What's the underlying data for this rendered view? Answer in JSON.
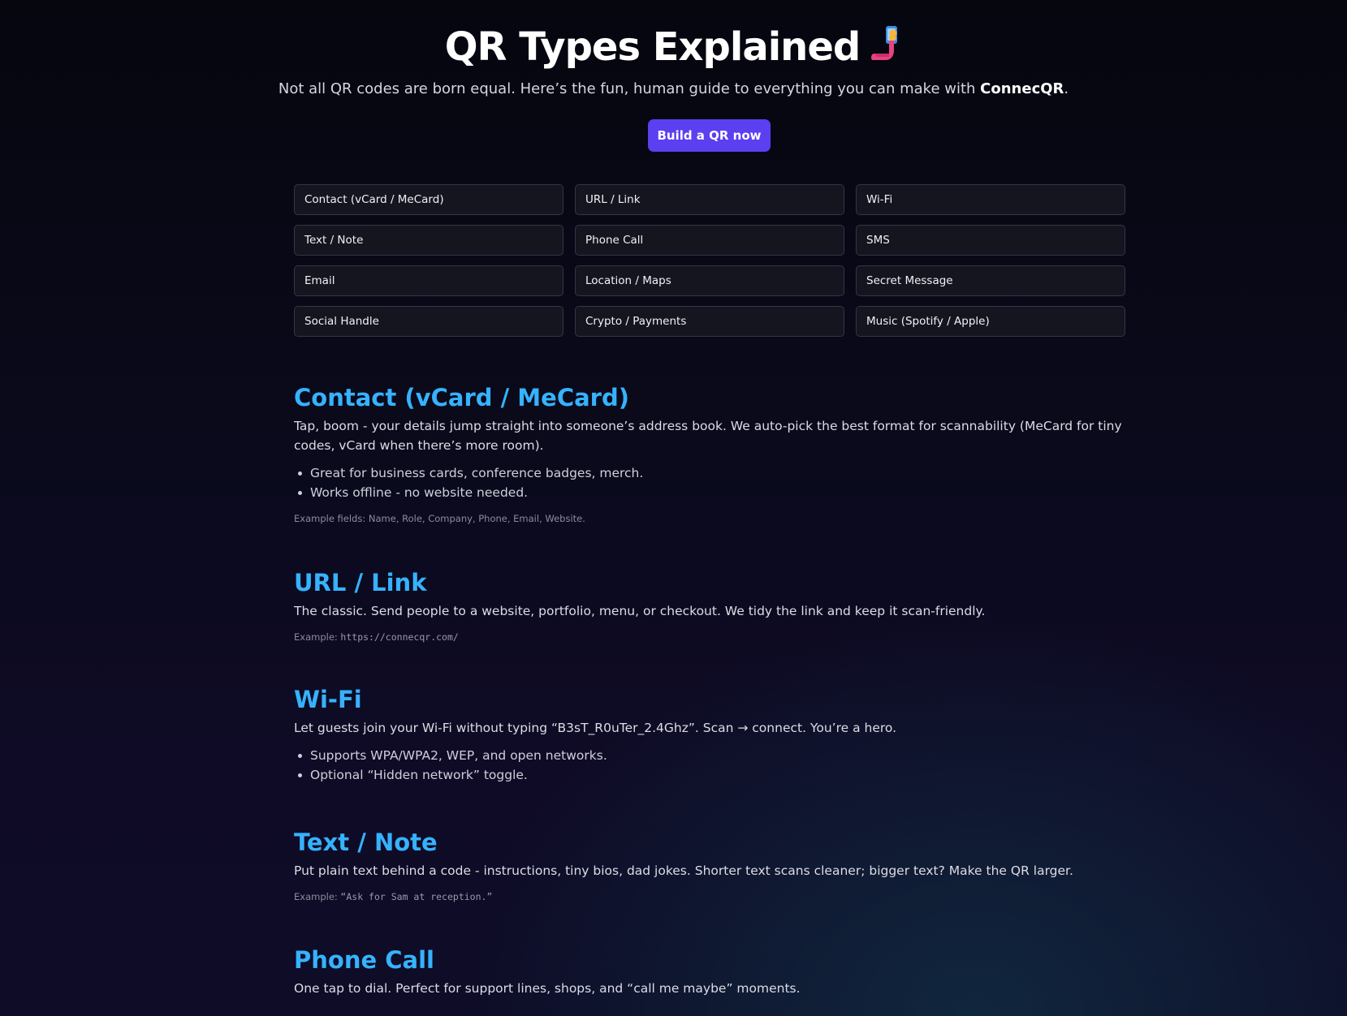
{
  "header": {
    "title": "QR Types Explained",
    "emoji_icon": "phone-in-hand-emoji",
    "subtitle_prefix": "Not all QR codes are born equal. Here’s the fun, human guide to everything you can make with ",
    "subtitle_brand": "ConnecQR",
    "subtitle_suffix": ".",
    "cta_label": "Build a QR now"
  },
  "types": [
    "Contact (vCard / MeCard)",
    "URL / Link",
    "Wi-Fi",
    "Text / Note",
    "Phone Call",
    "SMS",
    "Email",
    "Location / Maps",
    "Secret Message",
    "Social Handle",
    "Crypto / Payments",
    "Music (Spotify / Apple)"
  ],
  "sections": {
    "contact": {
      "title": "Contact (vCard / MeCard)",
      "desc": "Tap, boom - your details jump straight into someone’s address book. We auto-pick the best format for scannability (MeCard for tiny codes, vCard when there’s more room).",
      "bullets": [
        "Great for business cards, conference badges, merch.",
        "Works offline - no website needed."
      ],
      "example": "Example fields: Name, Role, Company, Phone, Email, Website."
    },
    "url": {
      "title": "URL / Link",
      "desc": "The classic. Send people to a website, portfolio, menu, or checkout. We tidy the link and keep it scan-friendly.",
      "example_label": "Example: ",
      "example_code": "https://connecqr.com/"
    },
    "wifi": {
      "title": "Wi-Fi",
      "desc": "Let guests join your Wi-Fi without typing “B3sT_R0uTer_2.4Ghz”. Scan → connect. You’re a hero.",
      "bullets": [
        "Supports WPA/WPA2, WEP, and open networks.",
        "Optional “Hidden network” toggle."
      ]
    },
    "text": {
      "title": "Text / Note",
      "desc": "Put plain text behind a code - instructions, tiny bios, dad jokes. Shorter text scans cleaner; bigger text? Make the QR larger.",
      "example_label": "Example: ",
      "example_code": "“Ask for Sam at reception.”"
    },
    "phone": {
      "title": "Phone Call",
      "desc": "One tap to dial. Perfect for support lines, shops, and “call me maybe” moments."
    }
  },
  "colors": {
    "accent": "#5b3ff0",
    "heading": "#36b2ff",
    "background": "#0a0a1c"
  }
}
